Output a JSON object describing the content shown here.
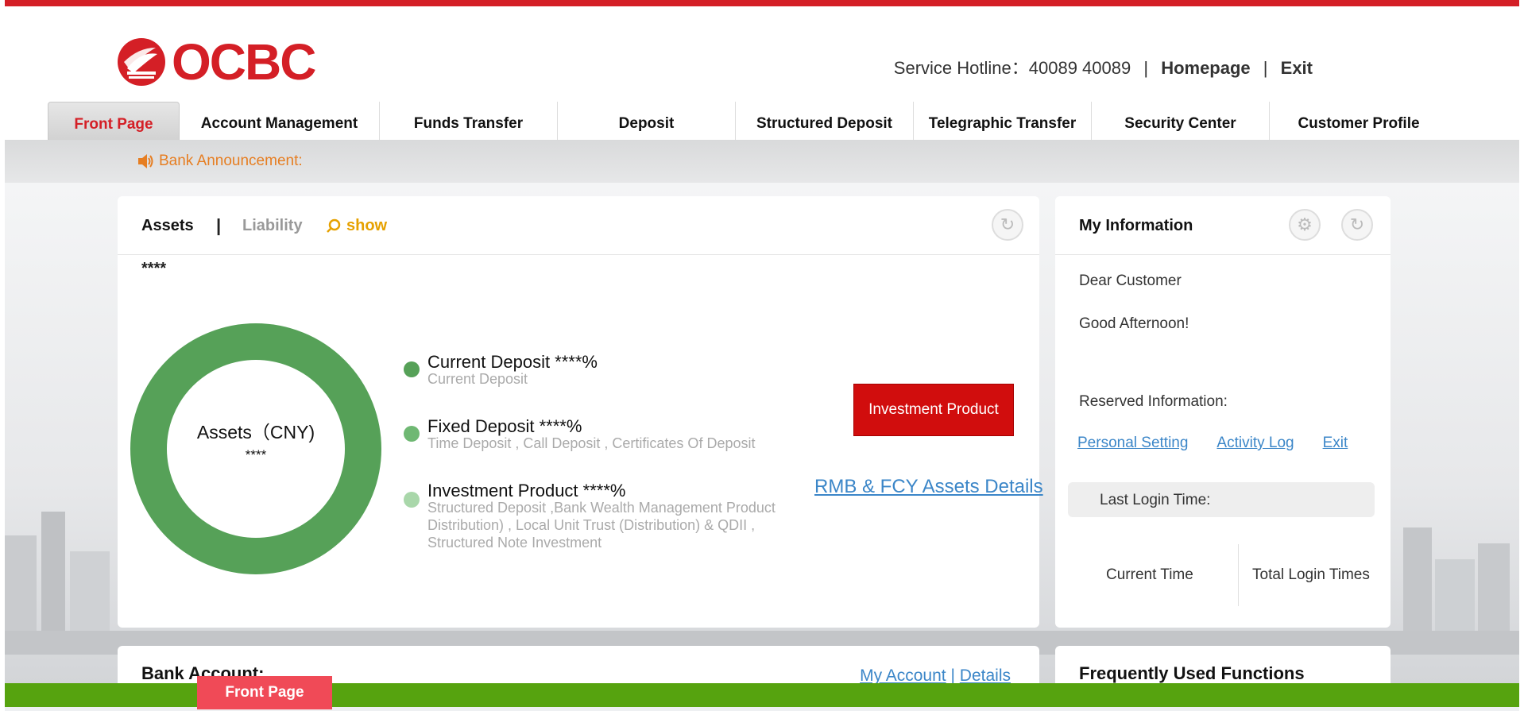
{
  "colors": {
    "brand": "#d41f26",
    "announce": "#e67e22",
    "show": "#e6a100",
    "link": "#3b86c8",
    "current": "#56a158",
    "fixed": "#6fb873",
    "invest": "#a9d7aa",
    "bottom_bar": "#56a30f",
    "bottom_tab": "#f04a57"
  },
  "header": {
    "logo": "OCBC",
    "hotline_label": "Service Hotline：",
    "hotline_number": "40089 40089",
    "sep": "|",
    "homepage": "Homepage",
    "exit": "Exit"
  },
  "nav": [
    {
      "label": "Front Page"
    },
    {
      "label": "Account Management"
    },
    {
      "label": "Funds Transfer"
    },
    {
      "label": "Deposit"
    },
    {
      "label": "Structured Deposit"
    },
    {
      "label": "Telegraphic Transfer"
    },
    {
      "label": "Security Center"
    },
    {
      "label": "Customer Profile"
    }
  ],
  "announcement": {
    "label": "Bank Announcement:",
    "icon": "speaker-icon"
  },
  "assets_card": {
    "tab_assets": "Assets",
    "tab_sep": "|",
    "tab_liability": "Liability",
    "show": "show",
    "total_mask": "****",
    "donut_label": "Assets（CNY)",
    "donut_value": "****",
    "legend": [
      {
        "title": "Current Deposit ****%",
        "sub": "Current Deposit"
      },
      {
        "title": "Fixed Deposit ****%",
        "sub": "Time Deposit , Call Deposit , Certificates Of Deposit"
      },
      {
        "title": "Investment Product ****%",
        "sub": "Structured Deposit ,Bank Wealth Management Product Distribution) , Local Unit Trust (Distribution) & QDII , Structured Note Investment"
      }
    ],
    "invest_button": "Investment Product",
    "details_link": "RMB & FCY Assets Details"
  },
  "info_card": {
    "title": "My Information",
    "greeting1": "Dear Customer",
    "greeting2": "Good Afternoon!",
    "reserved": "Reserved Information:",
    "links": [
      "Personal Setting",
      "Activity Log",
      "Exit"
    ],
    "last_login": "Last Login Time:",
    "current_time": "Current Time",
    "total_logins": "Total Login Times"
  },
  "lower": {
    "bank_account": "Bank Account:",
    "my_account": "My Account",
    "details": "Details",
    "sep": "|",
    "frequent": "Frequently Used Functions"
  },
  "bottom_tab": "Front Page"
}
